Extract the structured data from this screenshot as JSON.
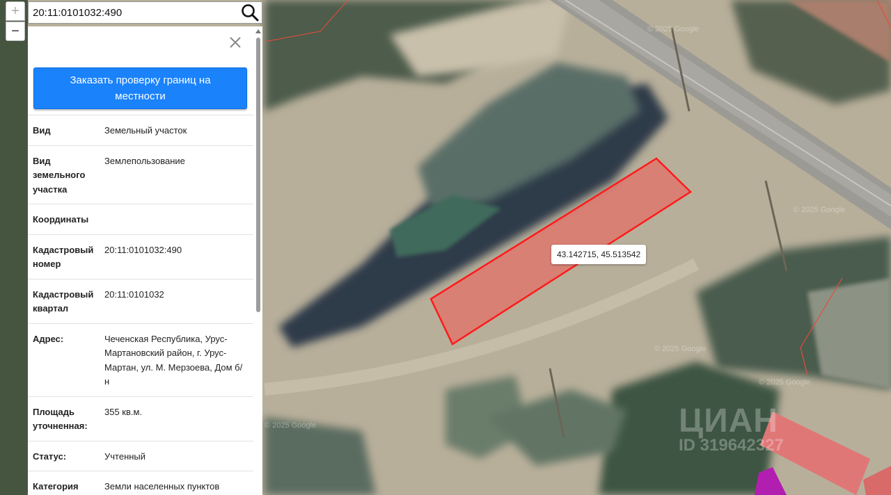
{
  "search": {
    "value": "20:11:0101032:490"
  },
  "zoom": {
    "in_label": "+",
    "out_label": "−"
  },
  "panel": {
    "order_button_label": "Заказать проверку границ на местности",
    "properties": [
      {
        "key": "Вид",
        "value": "Земельный участок"
      },
      {
        "key": "Вид земельного участка",
        "value": "Землепользование"
      },
      {
        "key": "Координаты",
        "value": ""
      },
      {
        "key": "Кадастровый номер",
        "value": "20:11:0101032:490"
      },
      {
        "key": "Кадастровый квартал",
        "value": "20:11:0101032"
      },
      {
        "key": "Адрес:",
        "value": "Чеченская Республика, Урус-Мартановский район, г. Урус-Мартан, ул. М. Мерзоева, Дом б/н"
      },
      {
        "key": "Площадь уточненная:",
        "value": "355 кв.м."
      },
      {
        "key": "Статус:",
        "value": "Учтенный"
      },
      {
        "key": "Категория земель",
        "value": "Земли населенных пунктов"
      }
    ]
  },
  "map": {
    "coord_tooltip": "43.142715, 45.513542",
    "google_watermarks": [
      "© 2025 Google",
      "© 2025 Google",
      "© 2025 Google",
      "© 2025 Google",
      "© 2025 Google"
    ],
    "cian_watermark": {
      "name": "ЦИАН",
      "id": "ID 319642327"
    },
    "parcel_color": "#ff1a1a"
  },
  "icons": {
    "search": "search-icon",
    "close": "close-icon"
  }
}
